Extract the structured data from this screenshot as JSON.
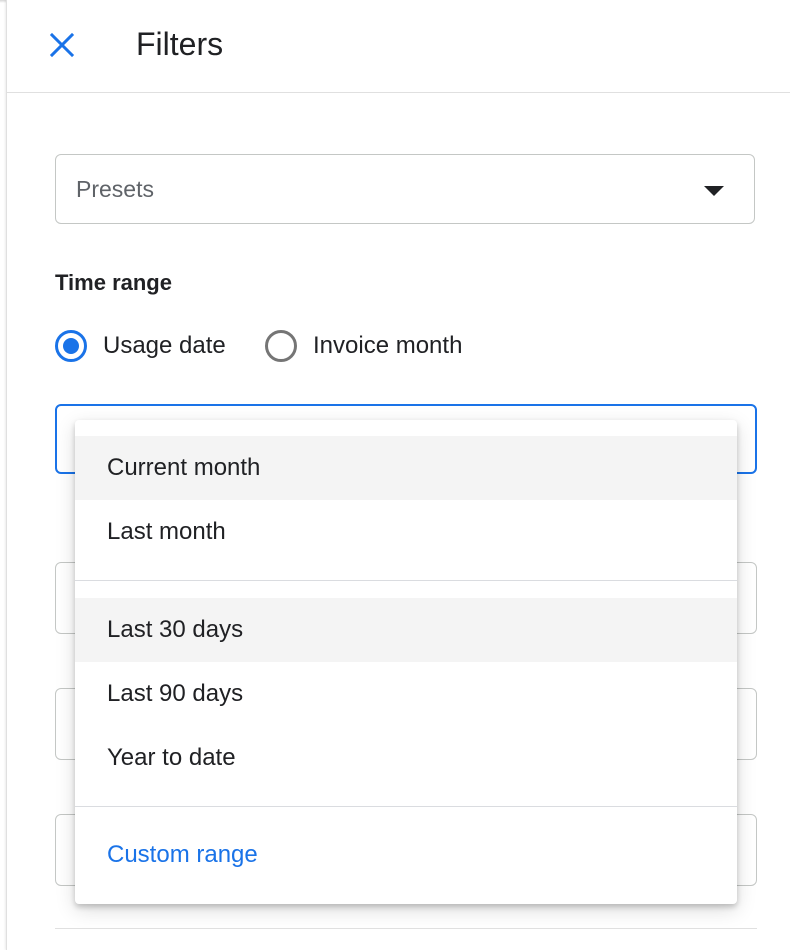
{
  "header": {
    "close_icon": "close-icon",
    "title": "Filters"
  },
  "presets": {
    "label": "Presets",
    "arrow_icon": "arrow-drop-down-icon"
  },
  "time_range": {
    "label": "Time range",
    "options": [
      {
        "label": "Usage date",
        "checked": true
      },
      {
        "label": "Invoice month",
        "checked": false
      }
    ]
  },
  "menu": {
    "items": [
      {
        "label": "Current month",
        "highlighted": true
      },
      {
        "label": "Last month",
        "highlighted": false
      },
      {
        "label": "Last 30 days",
        "highlighted": true
      },
      {
        "label": "Last 90 days",
        "highlighted": false
      },
      {
        "label": "Year to date",
        "highlighted": false
      },
      {
        "label": "Custom range",
        "highlighted": false
      }
    ]
  },
  "colors": {
    "accent": "#1a73e8",
    "text": "#202124",
    "muted": "#5f6368",
    "border": "#c4c7c5",
    "hover": "#f4f4f4"
  }
}
